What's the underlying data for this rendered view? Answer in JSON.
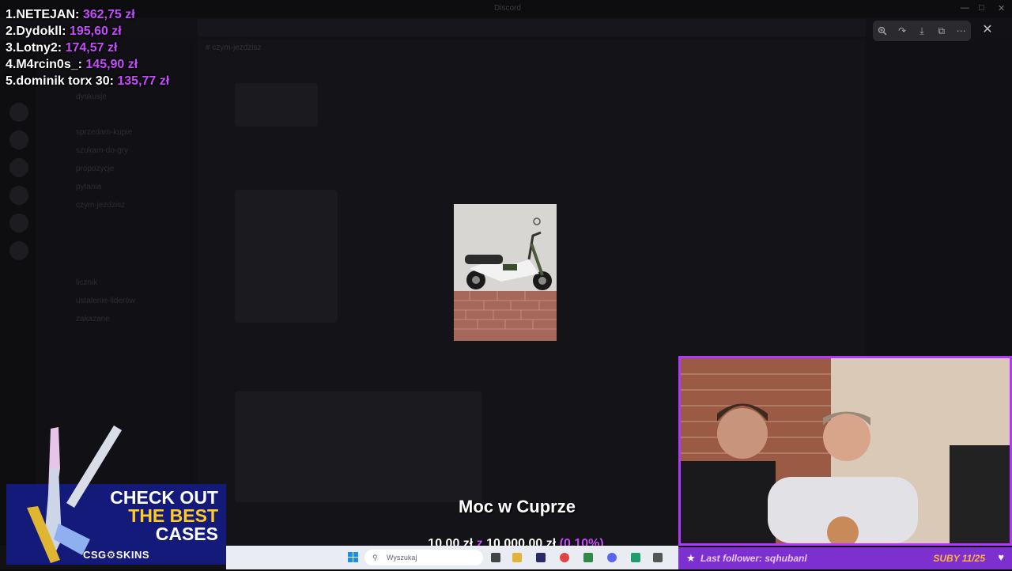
{
  "window": {
    "title": "Discord"
  },
  "channel": {
    "name": "czym-jezdzisz"
  },
  "channels": [
    "dyskusje",
    "sprzedam-kupie",
    "szukam-do-gry",
    "propozycje",
    "pytania",
    "czym-jezdzisz",
    "licznik",
    "ustalenie-liderów",
    "zakazane"
  ],
  "leaderboard": [
    {
      "name": "1.NETEJAN:",
      "amount": "362,75 zł"
    },
    {
      "name": "2.Dydokll:",
      "amount": "195,60 zł"
    },
    {
      "name": "3.Lotny2:",
      "amount": "174,57 zł"
    },
    {
      "name": "4.M4rcin0s_:",
      "amount": "145,90 zł"
    },
    {
      "name": "5.dominik torx 30:",
      "amount": "135,77 zł"
    }
  ],
  "ad": {
    "line1": "CHECK OUT",
    "line2": "THE BEST",
    "line3": "CASES",
    "brand": "CSG⚙SKINS"
  },
  "goal": {
    "title": "Moc w Cuprze",
    "current": "10,00 zł",
    "separator": "z",
    "target": "10 000,00 zł",
    "percent": "(0,10%)",
    "progress": 0.001
  },
  "taskbar": {
    "search_placeholder": "Wyszukaj"
  },
  "webcam": {
    "last_follower": "Last follower: sqhubanl",
    "subs": "SUBY 11/25"
  },
  "colors": {
    "accent": "#c64bff",
    "cam_border": "#b338ff",
    "ad_bg": "#141a7a",
    "ad_yellow": "#ffcc1f"
  },
  "icons": [
    "zoom-in-icon",
    "share-icon",
    "download-icon",
    "open-external-icon",
    "more-icon",
    "close-icon"
  ]
}
